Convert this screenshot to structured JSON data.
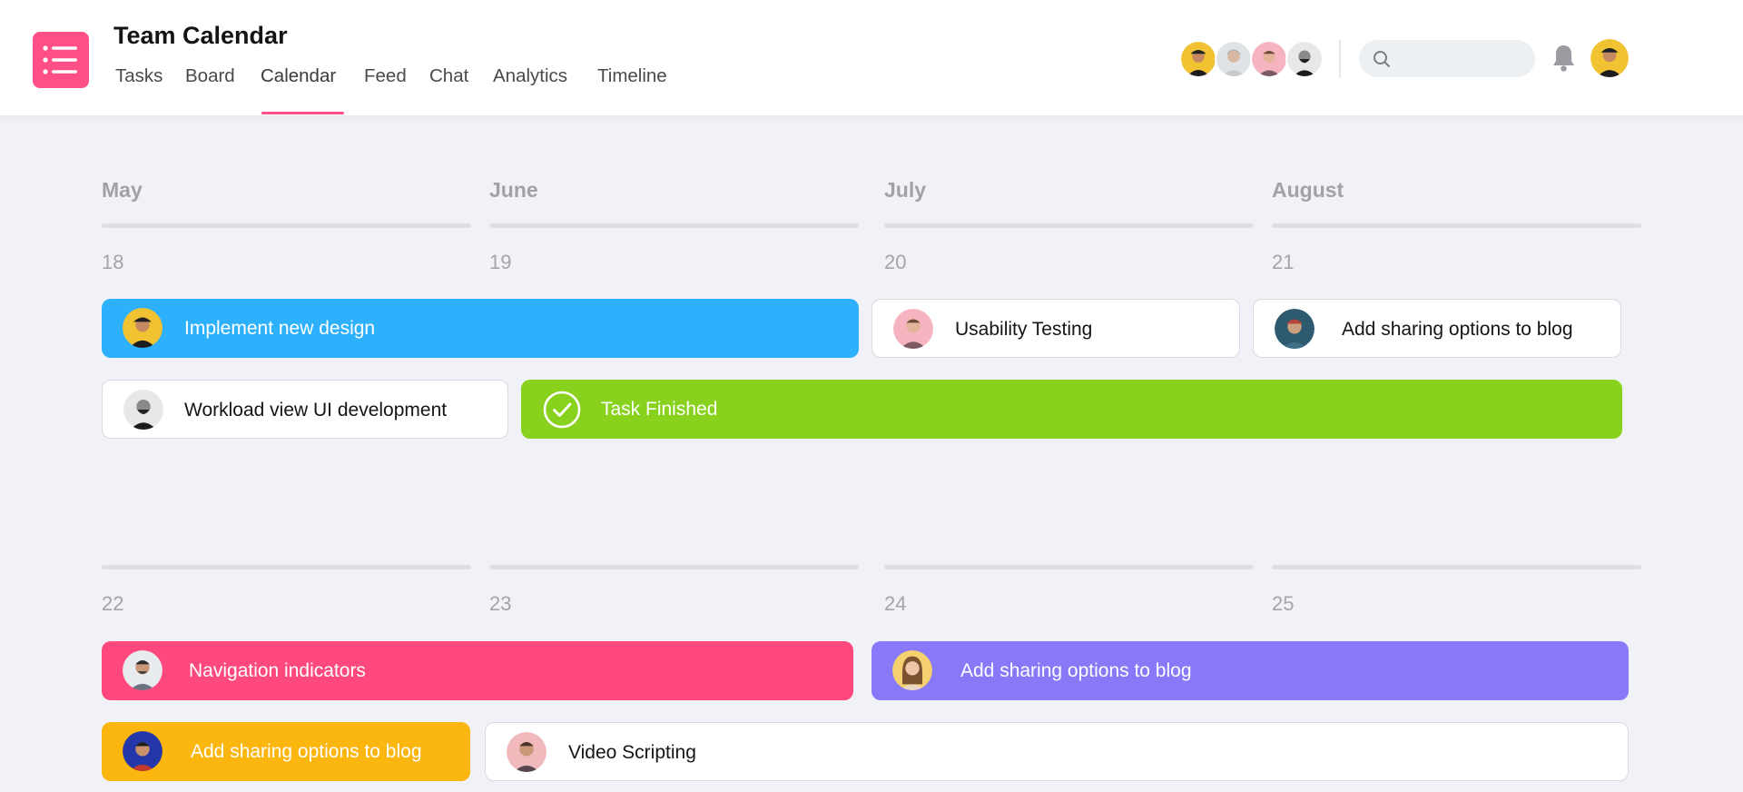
{
  "app": {
    "title": "Team Calendar"
  },
  "nav": {
    "tabs": [
      {
        "label": "Tasks"
      },
      {
        "label": "Board"
      },
      {
        "label": "Calendar",
        "active": true
      },
      {
        "label": "Feed"
      },
      {
        "label": "Chat"
      },
      {
        "label": "Analytics"
      },
      {
        "label": "Timeline"
      }
    ]
  },
  "header": {
    "team_avatars": [
      "avatar-yellow-man-cap",
      "avatar-grey-woman",
      "avatar-pink-man",
      "avatar-bw-man-beard"
    ],
    "search": {
      "placeholder": "",
      "value": ""
    },
    "notification_icon": "bell-icon",
    "user_avatar": "avatar-yellow-man-cap"
  },
  "calendar": {
    "months": [
      "May",
      "June",
      "July",
      "August"
    ],
    "week1_days": [
      "18",
      "19",
      "20",
      "21"
    ],
    "week2_days": [
      "22",
      "23",
      "24",
      "25"
    ],
    "tasks": [
      {
        "label": "Implement new design",
        "style": "colored",
        "color": "#2eb1fd"
      },
      {
        "label": "Usability Testing",
        "style": "white"
      },
      {
        "label": "Add sharing options to blog",
        "style": "white"
      },
      {
        "label": "Workload view UI development",
        "style": "white"
      },
      {
        "label": "Task Finished",
        "style": "colored",
        "color": "#88d21e",
        "icon": "check-circle-icon"
      },
      {
        "label": "Navigation indicators",
        "style": "colored",
        "color": "#ff497d"
      },
      {
        "label": "Add sharing options to blog",
        "style": "colored",
        "color": "#8779f7"
      },
      {
        "label": "Add sharing options to blog",
        "style": "colored",
        "color": "#fbb610"
      },
      {
        "label": "Video Scripting",
        "style": "white"
      }
    ]
  },
  "colors": {
    "accent": "#ff4f86",
    "background": "#f1f2f7"
  }
}
